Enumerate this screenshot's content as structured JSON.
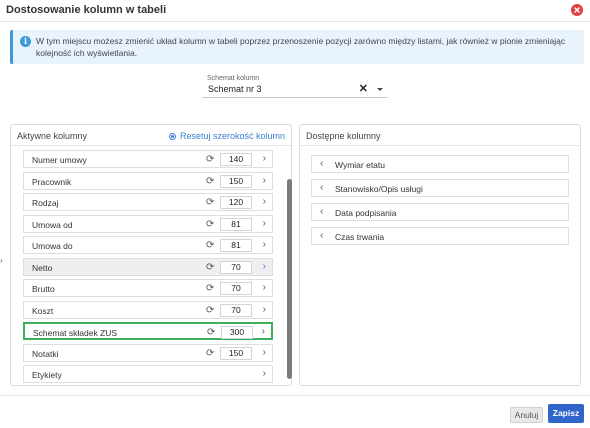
{
  "dialog": {
    "title": "Dostosowanie kolumn w tabeli",
    "close_icon": "close-icon",
    "info_text": "W tym miejscu możesz zmienić układ kolumn w tabeli poprzez przenoszenie pozycji zarówno między listami, jak również w pionie zmieniając kolejność ich wyświetlania.",
    "info_icon_glyph": "i"
  },
  "schema": {
    "label": "Schemat kolumn",
    "value": "Schemat nr 3",
    "clear_glyph": "✕"
  },
  "active": {
    "title": "Aktywne kolumny",
    "reset_label": "Resetuj szerokość kolumn",
    "rows": [
      {
        "label": "Numer umowy",
        "width": "140"
      },
      {
        "label": "Pracownik",
        "width": "150"
      },
      {
        "label": "Rodzaj",
        "width": "120"
      },
      {
        "label": "Umowa od",
        "width": "81"
      },
      {
        "label": "Umowa do",
        "width": "81"
      },
      {
        "label": "Netto",
        "width": "70"
      },
      {
        "label": "Brutto",
        "width": "70"
      },
      {
        "label": "Koszt",
        "width": "70"
      },
      {
        "label": "Schemat składek ZUS",
        "width": "300"
      },
      {
        "label": "Notatki",
        "width": "150"
      },
      {
        "label": "Etykiety",
        "width": ""
      }
    ],
    "highlighted_row": "Netto",
    "selected_row": "Schemat składek ZUS"
  },
  "available": {
    "title": "Dostępne kolumny",
    "items": [
      {
        "label": "Wymiar etatu"
      },
      {
        "label": "Stanowisko/Opis usługi"
      },
      {
        "label": "Data podpisania"
      },
      {
        "label": "Czas trwania"
      }
    ]
  },
  "footer": {
    "cancel_label": "Anuluj",
    "save_label": "Zapisz"
  },
  "colors": {
    "accent": "#3066cc",
    "link": "#3d7fd0",
    "selected_border": "#3cae5c",
    "info_bg": "#e8f3fb",
    "close": "#e04040"
  }
}
